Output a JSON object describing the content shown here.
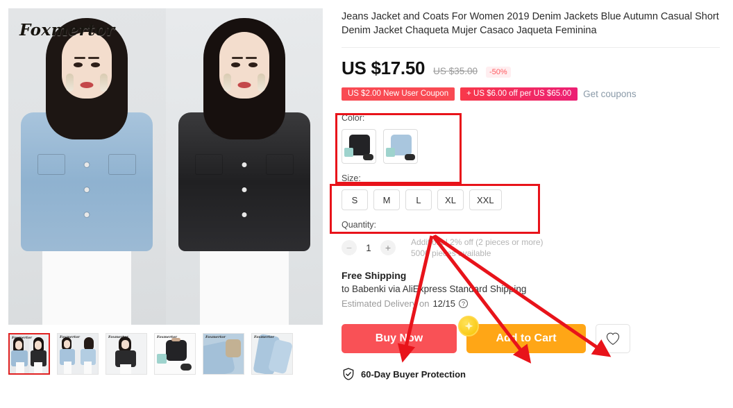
{
  "product": {
    "title": "Jeans Jacket and Coats For Women 2019 Denim Jackets Blue Autumn Casual Short Denim Jacket Chaqueta Mujer Casaco Jaqueta Feminina",
    "watermark": "Foxmertor"
  },
  "price": {
    "current": "US $17.50",
    "original": "US $35.00",
    "discount": "-50%"
  },
  "coupons": {
    "coupon1": "US $2.00 New User Coupon",
    "coupon2": "+ US $6.00 off per US $65.00",
    "get_link": "Get coupons"
  },
  "options": {
    "color_label": "Color:",
    "colors": [
      {
        "name": "black",
        "hex": "#232326"
      },
      {
        "name": "blue",
        "hex": "#a9c6de"
      }
    ],
    "size_label": "Size:",
    "sizes": [
      "S",
      "M",
      "L",
      "XL",
      "XXL"
    ]
  },
  "quantity": {
    "label": "Quantity:",
    "value": "1",
    "minus": "−",
    "plus": "+",
    "note_line1": "Additional 2% off (2 pieces or more)",
    "note_line2": "5000 pieces available"
  },
  "shipping": {
    "title": "Free Shipping",
    "method": "to Babenki via AliExpress Standard Shipping",
    "estimate_prefix": "Estimated Delivery on",
    "estimate_date": "12/15"
  },
  "actions": {
    "buy_now": "Buy Now",
    "add_to_cart": "Add to Cart",
    "wishlist_icon": "heart-icon",
    "coin_icon": "coin-sparkle-icon"
  },
  "guarantee": {
    "text": "60-Day Buyer Protection",
    "icon": "shield-check-icon"
  },
  "gallery": {
    "thumbnails": [
      {
        "id": 1,
        "selected": true,
        "kind": "two-models"
      },
      {
        "id": 2,
        "selected": false,
        "kind": "two-models-denim"
      },
      {
        "id": 3,
        "selected": false,
        "kind": "black-jacket-model"
      },
      {
        "id": 4,
        "selected": false,
        "kind": "black-flatlay"
      },
      {
        "id": 5,
        "selected": false,
        "kind": "denim-detail"
      },
      {
        "id": 6,
        "selected": false,
        "kind": "denim-sleeve"
      }
    ]
  },
  "annotations": {
    "color_box": "highlight-color-selector",
    "size_box": "highlight-size-selector",
    "arrows": [
      "to-buy-now",
      "to-add-to-cart",
      "to-wishlist"
    ],
    "color": "#e8131a"
  }
}
